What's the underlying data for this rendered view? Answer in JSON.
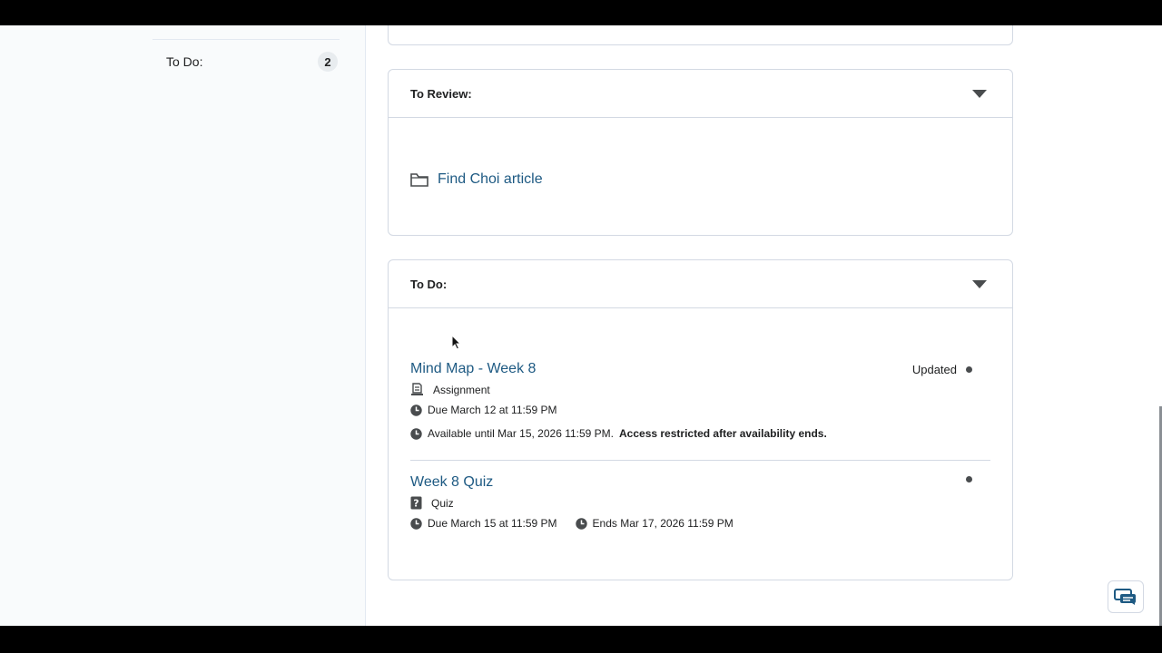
{
  "sidebar": {
    "todo_label": "To Do:",
    "todo_count": "2"
  },
  "review_panel": {
    "title": "To Review:",
    "item_label": "Find Choi article",
    "item_icon": "folder-icon"
  },
  "todo_panel": {
    "title": "To Do:",
    "items": [
      {
        "title": "Mind Map - Week 8",
        "status": "Updated",
        "type": "Assignment",
        "type_icon": "assignment-icon",
        "due": "Due March 12 at 11:59 PM",
        "availability_text": "Available until Mar 15, 2026 11:59 PM.",
        "availability_note": "Access restricted after availability ends."
      },
      {
        "title": "Week 8 Quiz",
        "type": "Quiz",
        "type_icon": "quiz-icon",
        "due": "Due March 15 at 11:59 PM",
        "ends": "Ends Mar 17, 2026 11:59 PM"
      }
    ]
  },
  "colors": {
    "link": "#1e5a83",
    "border": "#d3d9e3",
    "sidebar_bg": "#f9fbfc"
  }
}
